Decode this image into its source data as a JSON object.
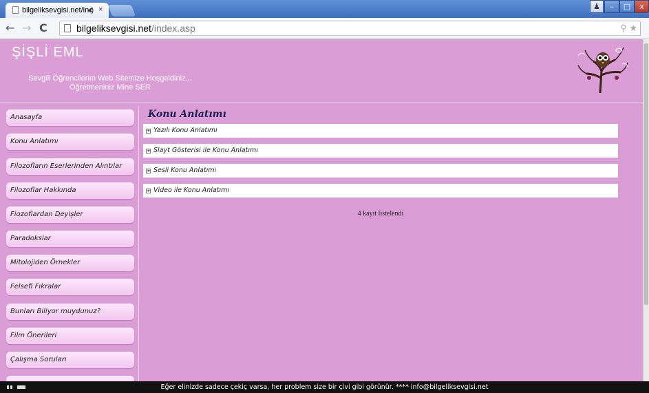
{
  "browser": {
    "tab_title": "bilgeliksevgisi.net/inc",
    "tab_audio_icon": "speaker-icon",
    "tab_close": "×",
    "window_minimize": "–",
    "window_maximize": "□",
    "window_close": "x",
    "url_host": "bilgeliksevgisi.net",
    "url_path": "/index.asp",
    "menu_icon": "≡"
  },
  "site": {
    "title": "ŞİŞLİ EML",
    "welcome_line1": "Sevgili Öğrencilerim Web Sitemize Hoşgeldiniz...",
    "welcome_line2": "Öğretmeniniz Mine SER"
  },
  "sidebar": {
    "items": [
      {
        "label": "Anasayfa"
      },
      {
        "label": "Konu Anlatımı"
      },
      {
        "label": "Filozofların Eserlerinden Alıntılar"
      },
      {
        "label": "Filozoflar Hakkında"
      },
      {
        "label": "Fiozoflardan Deyişler"
      },
      {
        "label": "Paradokslar"
      },
      {
        "label": "Mitolojiden Örnekler"
      },
      {
        "label": "Felsefi Fıkralar"
      },
      {
        "label": "Bunları Biliyor muydunuz?"
      },
      {
        "label": "Film Önerileri"
      },
      {
        "label": "Çalışma Soruları"
      },
      {
        "label": ""
      }
    ]
  },
  "content": {
    "title": "Konu Anlatımı",
    "rows": [
      {
        "label": "Yazılı Konu Anlatımı"
      },
      {
        "label": "Slayt Gösterisi ile Konu Anlatımı"
      },
      {
        "label": "Sesli Konu Anlatımı"
      },
      {
        "label": "Video ile Konu Anlatımı"
      }
    ],
    "count_text": "4 kayıt listelendi"
  },
  "footer": {
    "text": "Eğer elinizde sadece çekiç varsa, her problem size bir çivi gibi görünür. **** info@bilgeliksevgisi.net"
  },
  "colors": {
    "page_bg": "#db9dd5",
    "sidebar_item": "#f2c7ee",
    "footer_bg": "#111111",
    "titlebar": "#4e7fca"
  }
}
